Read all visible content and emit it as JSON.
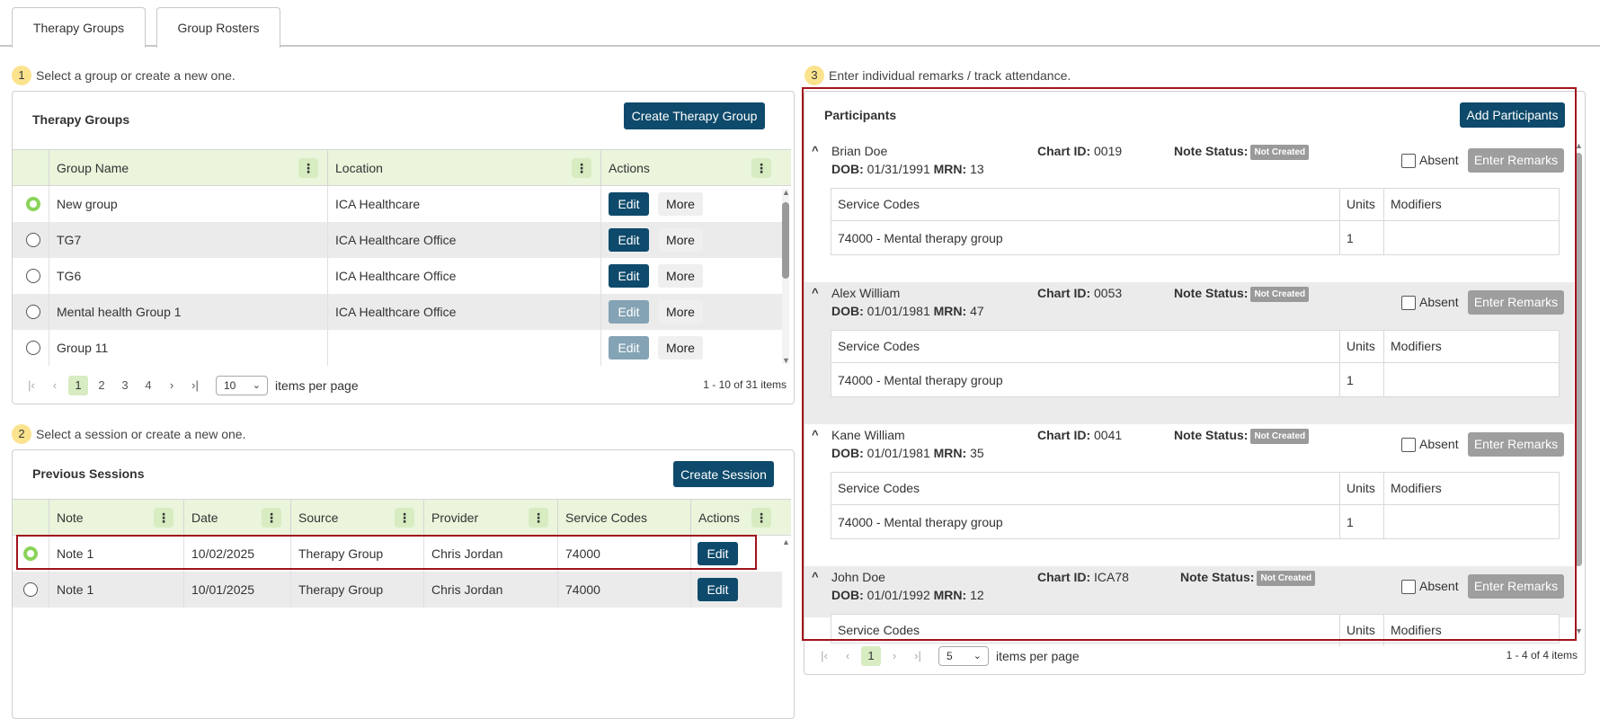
{
  "tabs": [
    "Therapy Groups",
    "Group Rosters"
  ],
  "steps": {
    "s1": {
      "num": "1",
      "text": "Select a group or create a new one."
    },
    "s2": {
      "num": "2",
      "text": "Select a session or create a new one."
    },
    "s3": {
      "num": "3",
      "text": "Enter individual remarks / track attendance."
    }
  },
  "groups_panel": {
    "title": "Therapy Groups",
    "create_label": "Create Therapy Group",
    "columns": [
      "Group Name",
      "Location",
      "Actions"
    ],
    "rows": [
      {
        "name": "New group",
        "location": "ICA Healthcare",
        "edit": "Edit",
        "more": "More",
        "selected": true,
        "edit_disabled": false
      },
      {
        "name": "TG7",
        "location": "ICA Healthcare Office",
        "edit": "Edit",
        "more": "More",
        "selected": false,
        "edit_disabled": false
      },
      {
        "name": "TG6",
        "location": "ICA Healthcare Office",
        "edit": "Edit",
        "more": "More",
        "selected": false,
        "edit_disabled": false
      },
      {
        "name": "Mental health Group 1",
        "location": "ICA Healthcare Office",
        "edit": "Edit",
        "more": "More",
        "selected": false,
        "edit_disabled": true
      },
      {
        "name": "Group 11",
        "location": "",
        "edit": "Edit",
        "more": "More",
        "selected": false,
        "edit_disabled": true
      }
    ],
    "pager": {
      "pages": [
        "1",
        "2",
        "3",
        "4"
      ],
      "current": "1",
      "page_size": "10",
      "per_page_label": "items per page",
      "summary": "1 - 10 of 31 items"
    }
  },
  "sessions_panel": {
    "title": "Previous Sessions",
    "create_label": "Create Session",
    "columns": [
      "Note",
      "Date",
      "Source",
      "Provider",
      "Service Codes",
      "Actions"
    ],
    "rows": [
      {
        "note": "Note 1",
        "date": "10/02/2025",
        "source": "Therapy Group",
        "provider": "Chris Jordan",
        "codes": "74000",
        "edit": "Edit",
        "selected": true
      },
      {
        "note": "Note 1",
        "date": "10/01/2025",
        "source": "Therapy Group",
        "provider": "Chris Jordan",
        "codes": "74000",
        "edit": "Edit",
        "selected": false
      }
    ]
  },
  "participants_panel": {
    "title": "Participants",
    "add_label": "Add Participants",
    "labels": {
      "dob": "DOB:",
      "mrn": "MRN:",
      "chart": "Chart ID:",
      "note_status": "Note Status:",
      "absent": "Absent",
      "remarks": "Enter Remarks"
    },
    "svc_headers": [
      "Service Codes",
      "Units",
      "Modifiers"
    ],
    "participants": [
      {
        "name": "Brian Doe",
        "dob": "01/31/1991",
        "mrn": "13",
        "chart_id": "0019",
        "status": "Not Created",
        "code": "74000 - Mental therapy group",
        "units": "1",
        "modifiers": ""
      },
      {
        "name": "Alex William",
        "dob": "01/01/1981",
        "mrn": "47",
        "chart_id": "0053",
        "status": "Not Created",
        "code": "74000 - Mental therapy group",
        "units": "1",
        "modifiers": ""
      },
      {
        "name": "Kane William",
        "dob": "01/01/1981",
        "mrn": "35",
        "chart_id": "0041",
        "status": "Not Created",
        "code": "74000 - Mental therapy group",
        "units": "1",
        "modifiers": ""
      },
      {
        "name": "John Doe",
        "dob": "01/01/1992",
        "mrn": "12",
        "chart_id": "ICA78",
        "status": "Not Created",
        "code": "",
        "units": "",
        "modifiers": ""
      }
    ],
    "pager": {
      "pages": [
        "1"
      ],
      "current": "1",
      "page_size": "5",
      "per_page_label": "items per page",
      "summary": "1 - 4 of 4 items"
    }
  },
  "colors": {
    "primary": "#0e4a6b",
    "header_bg": "#eaf5dc",
    "highlight": "#a0131c",
    "step_badge": "#fbe38e"
  }
}
